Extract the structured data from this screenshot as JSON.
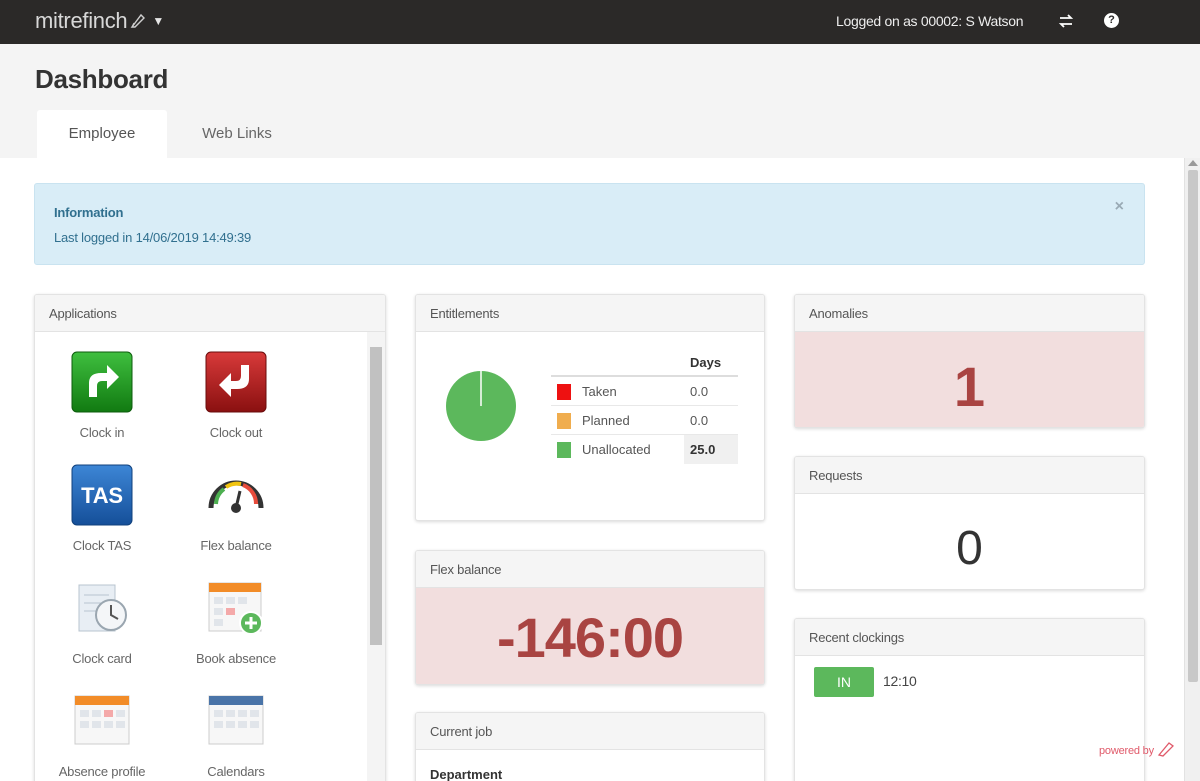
{
  "brand": {
    "name": "mitrefinch"
  },
  "topbar": {
    "logged_on": "Logged on as 00002: S Watson",
    "help_glyph": "?"
  },
  "page": {
    "title": "Dashboard"
  },
  "tabs": [
    {
      "label": "Employee",
      "active": true
    },
    {
      "label": "Web Links",
      "active": false
    }
  ],
  "alert": {
    "title": "Information",
    "message": "Last logged in 14/06/2019 14:49:39",
    "close": "×"
  },
  "applications": {
    "title": "Applications",
    "items": [
      {
        "label": "Clock in",
        "icon": "clock-in-arrow-icon"
      },
      {
        "label": "Clock out",
        "icon": "clock-out-arrow-icon"
      },
      {
        "label": "Clock TAS",
        "icon": "tas-icon",
        "icon_text": "TAS"
      },
      {
        "label": "Flex balance",
        "icon": "gauge-icon"
      },
      {
        "label": "Clock card",
        "icon": "clock-card-icon"
      },
      {
        "label": "Book absence",
        "icon": "calendar-add-icon"
      },
      {
        "label": "Absence profile",
        "icon": "calendar-icon"
      },
      {
        "label": "Calendars",
        "icon": "calendars-icon"
      }
    ]
  },
  "entitlements": {
    "title": "Entitlements",
    "column": "Days",
    "rows": [
      {
        "label": "Taken",
        "value": "0.0",
        "color": "#ee1111"
      },
      {
        "label": "Planned",
        "value": "0.0",
        "color": "#f0ad4e"
      },
      {
        "label": "Unallocated",
        "value": "25.0",
        "color": "#5cb85c"
      }
    ]
  },
  "flex_balance": {
    "title": "Flex balance",
    "value": "-146:00"
  },
  "current_job": {
    "title": "Current job",
    "department_label": "Department"
  },
  "anomalies": {
    "title": "Anomalies",
    "count": "1"
  },
  "requests": {
    "title": "Requests",
    "count": "0"
  },
  "recent_clockings": {
    "title": "Recent clockings",
    "items": [
      {
        "type": "IN",
        "time": "12:10"
      }
    ]
  },
  "footer": {
    "powered": "powered by"
  },
  "colors": {
    "topbar": "#2b2928",
    "alert_bg": "#d9edf7",
    "danger_bg": "#f2dede",
    "danger_text": "#a94442",
    "success": "#5cb85c"
  }
}
